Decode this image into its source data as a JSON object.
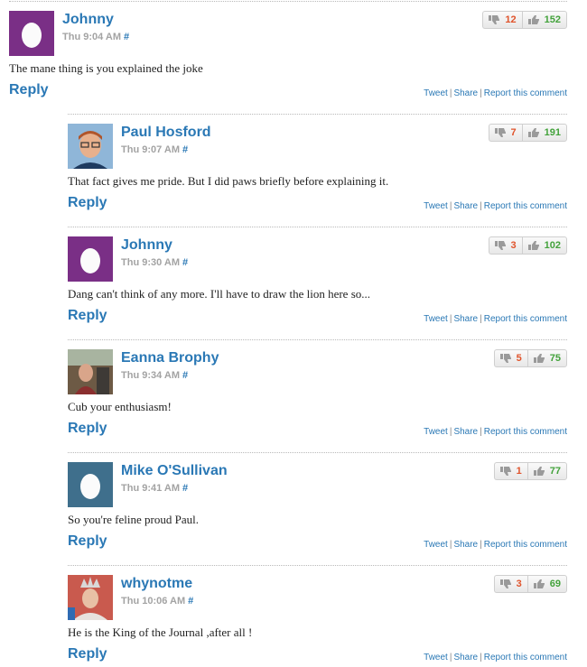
{
  "reply_label": "Reply",
  "permalink_symbol": "#",
  "actions": {
    "tweet": "Tweet",
    "share": "Share",
    "report": "Report this comment",
    "separator": "|"
  },
  "colors": {
    "link": "#2a78b5",
    "downvote": "#e0532b",
    "upvote": "#43a23b",
    "timestamp": "#a3a3a3"
  },
  "comments": [
    {
      "author": "Johnny",
      "time": "Thu 9:04 AM",
      "text": "The mane thing is you explained the joke",
      "down": "12",
      "up": "152",
      "avatar": "egg-purple-avatar"
    },
    {
      "author": "Paul Hosford",
      "time": "Thu 9:07 AM",
      "text": "That fact gives me pride. But I did paws briefly before explaining it.",
      "down": "7",
      "up": "191",
      "avatar": "photo-avatar"
    },
    {
      "author": "Johnny",
      "time": "Thu 9:30 AM",
      "text": "Dang can't think of any more. I'll have to draw the lion here so...",
      "down": "3",
      "up": "102",
      "avatar": "egg-purple-avatar"
    },
    {
      "author": "Eanna Brophy",
      "time": "Thu 9:34 AM",
      "text": "Cub your enthusiasm!",
      "down": "5",
      "up": "75",
      "avatar": "photo-avatar"
    },
    {
      "author": "Mike O'Sullivan",
      "time": "Thu 9:41 AM",
      "text": "So you're feline proud Paul.",
      "down": "1",
      "up": "77",
      "avatar": "egg-blue-avatar"
    },
    {
      "author": "whynotme",
      "time": "Thu 10:06 AM",
      "text": "He is the King of the Journal ,after all !",
      "down": "3",
      "up": "69",
      "avatar": "photo-avatar"
    }
  ]
}
